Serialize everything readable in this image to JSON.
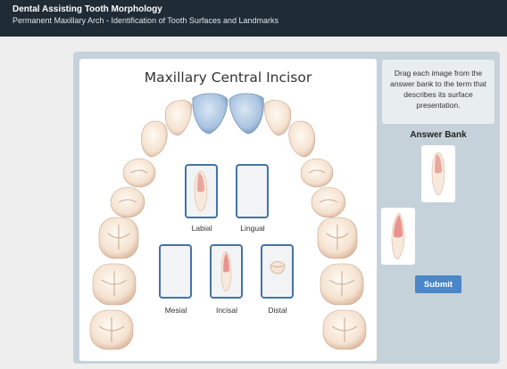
{
  "header": {
    "title": "Dental Assisting Tooth Morphology",
    "subtitle": "Permanent Maxillary Arch - Identification of Tooth Surfaces and Landmarks"
  },
  "stage": {
    "title": "Maxillary Central Incisor"
  },
  "slots": [
    {
      "label": "Labial",
      "filled": true,
      "image": "incisor-labial-view"
    },
    {
      "label": "Lingual",
      "filled": false
    },
    {
      "label": "Mesial",
      "filled": false
    },
    {
      "label": "Incisal",
      "filled": true,
      "image": "incisor-proximal-view"
    },
    {
      "label": "Distal",
      "filled": true,
      "image": "incisor-incisal-view"
    }
  ],
  "instructions": "Drag each image from the answer bank to the term that describes its surface presentation.",
  "answer_bank": {
    "title": "Answer Bank",
    "items": [
      {
        "image": "incisor-labial-view"
      },
      {
        "image": "incisor-proximal-view"
      }
    ]
  },
  "submit_label": "Submit",
  "colors": {
    "header_bg": "#1f2b35",
    "slot_border": "#4473a9",
    "highlight_teeth": "#a9c3e0",
    "button": "#4a86c8"
  }
}
